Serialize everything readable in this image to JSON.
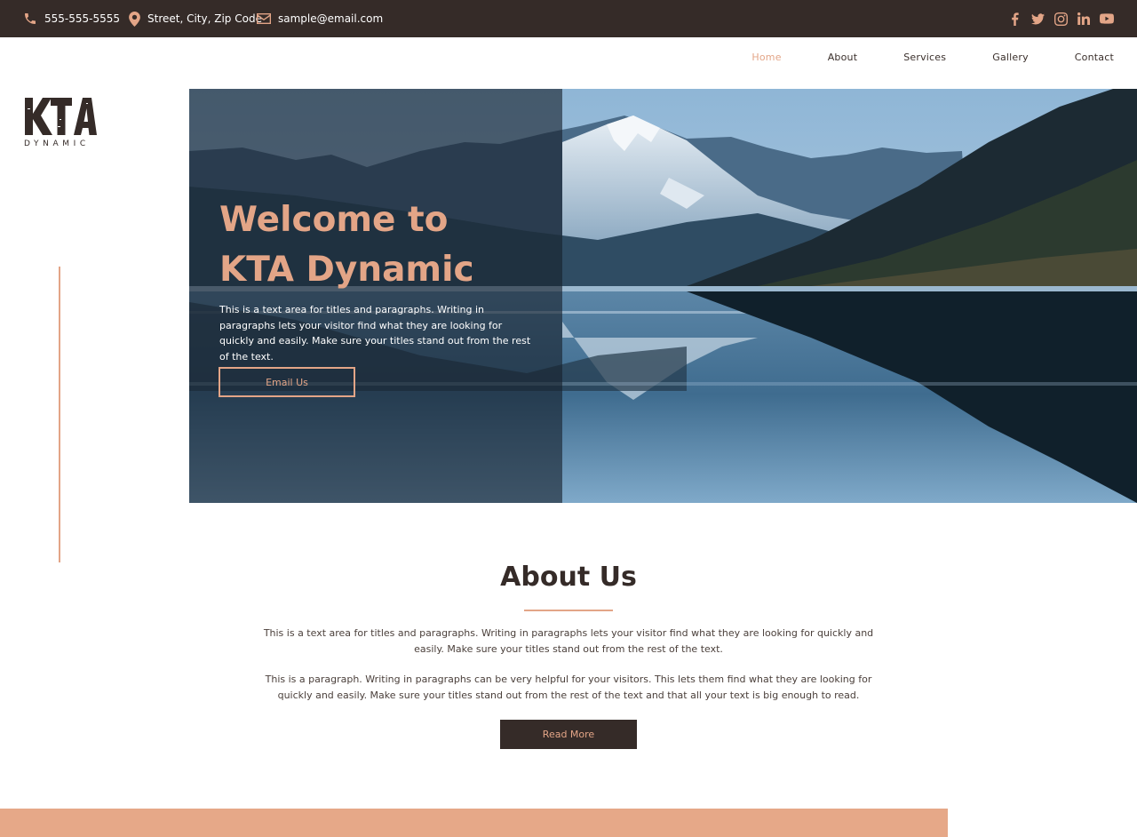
{
  "topbar": {
    "phone": "555-555-5555",
    "address": "Street, City, Zip Code",
    "email": "sample@email.com",
    "social": [
      "facebook-icon",
      "twitter-icon",
      "instagram-icon",
      "linkedin-icon",
      "youtube-icon"
    ]
  },
  "nav": {
    "items": [
      {
        "label": "Home",
        "active": true
      },
      {
        "label": "About",
        "active": false
      },
      {
        "label": "Services",
        "active": false
      },
      {
        "label": "Gallery",
        "active": false
      },
      {
        "label": "Contact",
        "active": false
      }
    ]
  },
  "logo": {
    "mark": "KTA",
    "sub": "DYNAMIC"
  },
  "hero": {
    "title_line1": "Welcome to",
    "title_line2": "KTA Dynamic",
    "text": "This is a text area for titles and paragraphs. Writing in paragraphs lets your visitor find what they are looking for quickly and easily. Make sure your titles stand out from the rest of the text.",
    "button": "Email Us"
  },
  "about": {
    "title": "About Us",
    "p1": "This is a text area for titles and paragraphs. Writing in paragraphs lets your visitor find what they are looking for quickly and easily. Make sure your titles stand out from the rest of the text.",
    "p2": "This is a paragraph. Writing in paragraphs can be very helpful for your visitors. This lets them find what they are looking for quickly and easily. Make sure your titles stand out from the rest of the text and that all your text is big enough to read.",
    "button": "Read More"
  },
  "colors": {
    "accent": "#e3a587",
    "dark": "#352b28"
  }
}
